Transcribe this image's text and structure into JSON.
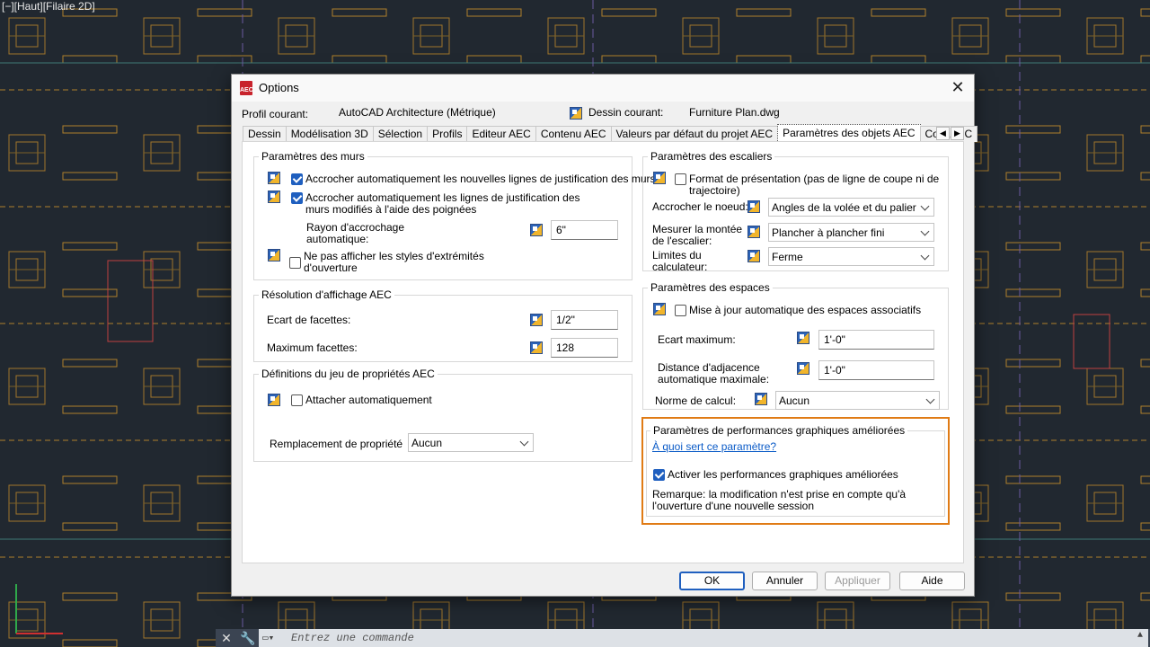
{
  "viewport": {
    "label": "[−][Haut][Filaire 2D]"
  },
  "command_line": {
    "placeholder": "Entrez une commande"
  },
  "dialog": {
    "title": "Options",
    "profile_label": "Profil courant:",
    "profile_value": "AutoCAD Architecture (Métrique)",
    "drawing_label": "Dessin courant:",
    "drawing_value": "Furniture Plan.dwg",
    "tabs": [
      "Dessin",
      "Modélisation 3D",
      "Sélection",
      "Profils",
      "Editeur AEC",
      "Contenu AEC",
      "Valeurs par défaut du projet AEC",
      "Paramètres des objets AEC",
      "Cote AEC"
    ],
    "active_tab": "Paramètres des objets AEC",
    "walls": {
      "title": "Paramètres des murs",
      "snap_new": "Accrocher automatiquement les nouvelles lignes de justification des murs",
      "snap_new_checked": true,
      "snap_modified_1": "Accrocher automatiquement les lignes de justification des",
      "snap_modified_2": "murs modifiés à l'aide des poignées",
      "snap_modified_checked": true,
      "radius_label_1": "Rayon d'accrochage",
      "radius_label_2": "automatique:",
      "radius_value": "6\"",
      "hide_opening_1": "Ne pas afficher les styles d'extrémités",
      "hide_opening_2": "d'ouverture",
      "hide_opening_checked": false
    },
    "resolution": {
      "title": "Résolution d'affichage AEC",
      "facet_gap_label": "Ecart de facettes:",
      "facet_gap_value": "1/2\"",
      "max_facets_label": "Maximum facettes:",
      "max_facets_value": "128"
    },
    "property_sets": {
      "title": "Définitions du jeu de propriétés AEC",
      "attach_label": "Attacher automatiquement",
      "attach_checked": false,
      "override_label": "Remplacement de propriété",
      "override_value": "Aucun"
    },
    "stairs": {
      "title": "Paramètres des escaliers",
      "presentation_1": "Format de présentation (pas de ligne de coupe ni de",
      "presentation_2": "trajectoire)",
      "presentation_checked": false,
      "node_label": "Accrocher le noeud:",
      "node_value": "Angles de la volée et du palier",
      "rise_label_1": "Mesurer la montée",
      "rise_label_2": "de l'escalier:",
      "rise_value": "Plancher à plancher fini",
      "limits_label_1": "Limites du",
      "limits_label_2": "calculateur:",
      "limits_value": "Ferme"
    },
    "spaces": {
      "title": "Paramètres des espaces",
      "auto_update": "Mise à jour automatique des espaces associatifs",
      "auto_update_checked": false,
      "max_gap_label": "Ecart maximum:",
      "max_gap_value": "1'-0\"",
      "adjacency_label_1": "Distance d'adjacence",
      "adjacency_label_2": "automatique maximale:",
      "adjacency_value": "1'-0\"",
      "norm_label": "Norme de calcul:",
      "norm_value": "Aucun"
    },
    "graphics": {
      "title": "Paramètres de performances graphiques améliorées",
      "help_link": "À quoi sert ce paramètre?",
      "enable_label": "Activer les performances graphiques améliorées",
      "enable_checked": true,
      "note_1": "Remarque: la modification n'est prise en compte qu'à",
      "note_2": "l'ouverture d'une nouvelle session",
      "highlight_color": "#e07b15"
    },
    "buttons": {
      "ok": "OK",
      "cancel": "Annuler",
      "apply": "Appliquer",
      "help": "Aide"
    }
  },
  "colors": {
    "accent": "#1f5fbf",
    "canvas_bg": "#212830",
    "cad_lines": "#c8902a"
  }
}
